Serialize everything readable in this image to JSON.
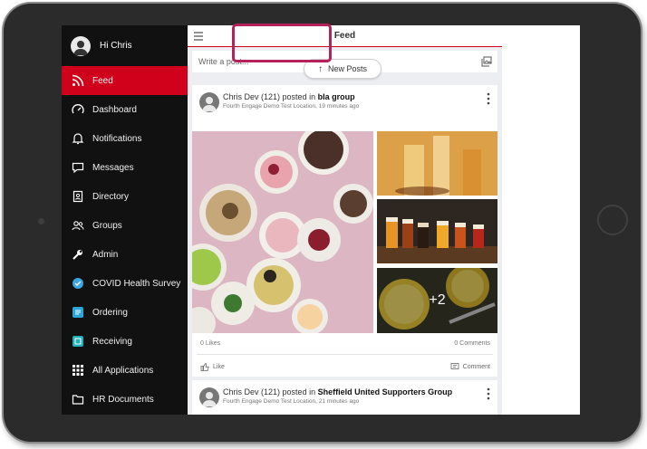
{
  "profile": {
    "greeting": "Hi Chris"
  },
  "sidebar": {
    "items": [
      {
        "label": "Feed",
        "icon": "rss-icon",
        "active": true
      },
      {
        "label": "Dashboard",
        "icon": "speedometer-icon"
      },
      {
        "label": "Notifications",
        "icon": "bell-icon"
      },
      {
        "label": "Messages",
        "icon": "chat-icon"
      },
      {
        "label": "Directory",
        "icon": "contact-card-icon"
      },
      {
        "label": "Groups",
        "icon": "people-icon"
      },
      {
        "label": "Admin",
        "icon": "wrench-icon"
      },
      {
        "label": "COVID Health Survey",
        "icon": "check-circle-icon"
      },
      {
        "label": "Ordering",
        "icon": "ordering-app-icon"
      },
      {
        "label": "Receiving",
        "icon": "receiving-app-icon"
      },
      {
        "label": "All Applications",
        "icon": "grid-icon"
      },
      {
        "label": "HR Documents",
        "icon": "folder-icon"
      }
    ]
  },
  "header": {
    "title": "Feed"
  },
  "compose": {
    "placeholder": "Write a post..."
  },
  "new_posts": {
    "label": "New Posts"
  },
  "posts": [
    {
      "author": "Chris Dev (121)",
      "action": "posted in",
      "group": "bla group",
      "location": "Fourth Engage Demo Test Location",
      "time": "19 minutes ago",
      "extra_photos": "+2",
      "likes": "0 Likes",
      "comments": "0 Comments",
      "like_label": "Like",
      "comment_label": "Comment"
    },
    {
      "author": "Chris Dev (121)",
      "action": "posted in",
      "group": "Sheffield United Supporters Group",
      "location": "Fourth Engage Demo Test Location",
      "time": "21 minutes ago"
    }
  ],
  "colors": {
    "accent": "#d0021b",
    "sidebar_bg": "#111111",
    "highlight": "#b5215a"
  }
}
